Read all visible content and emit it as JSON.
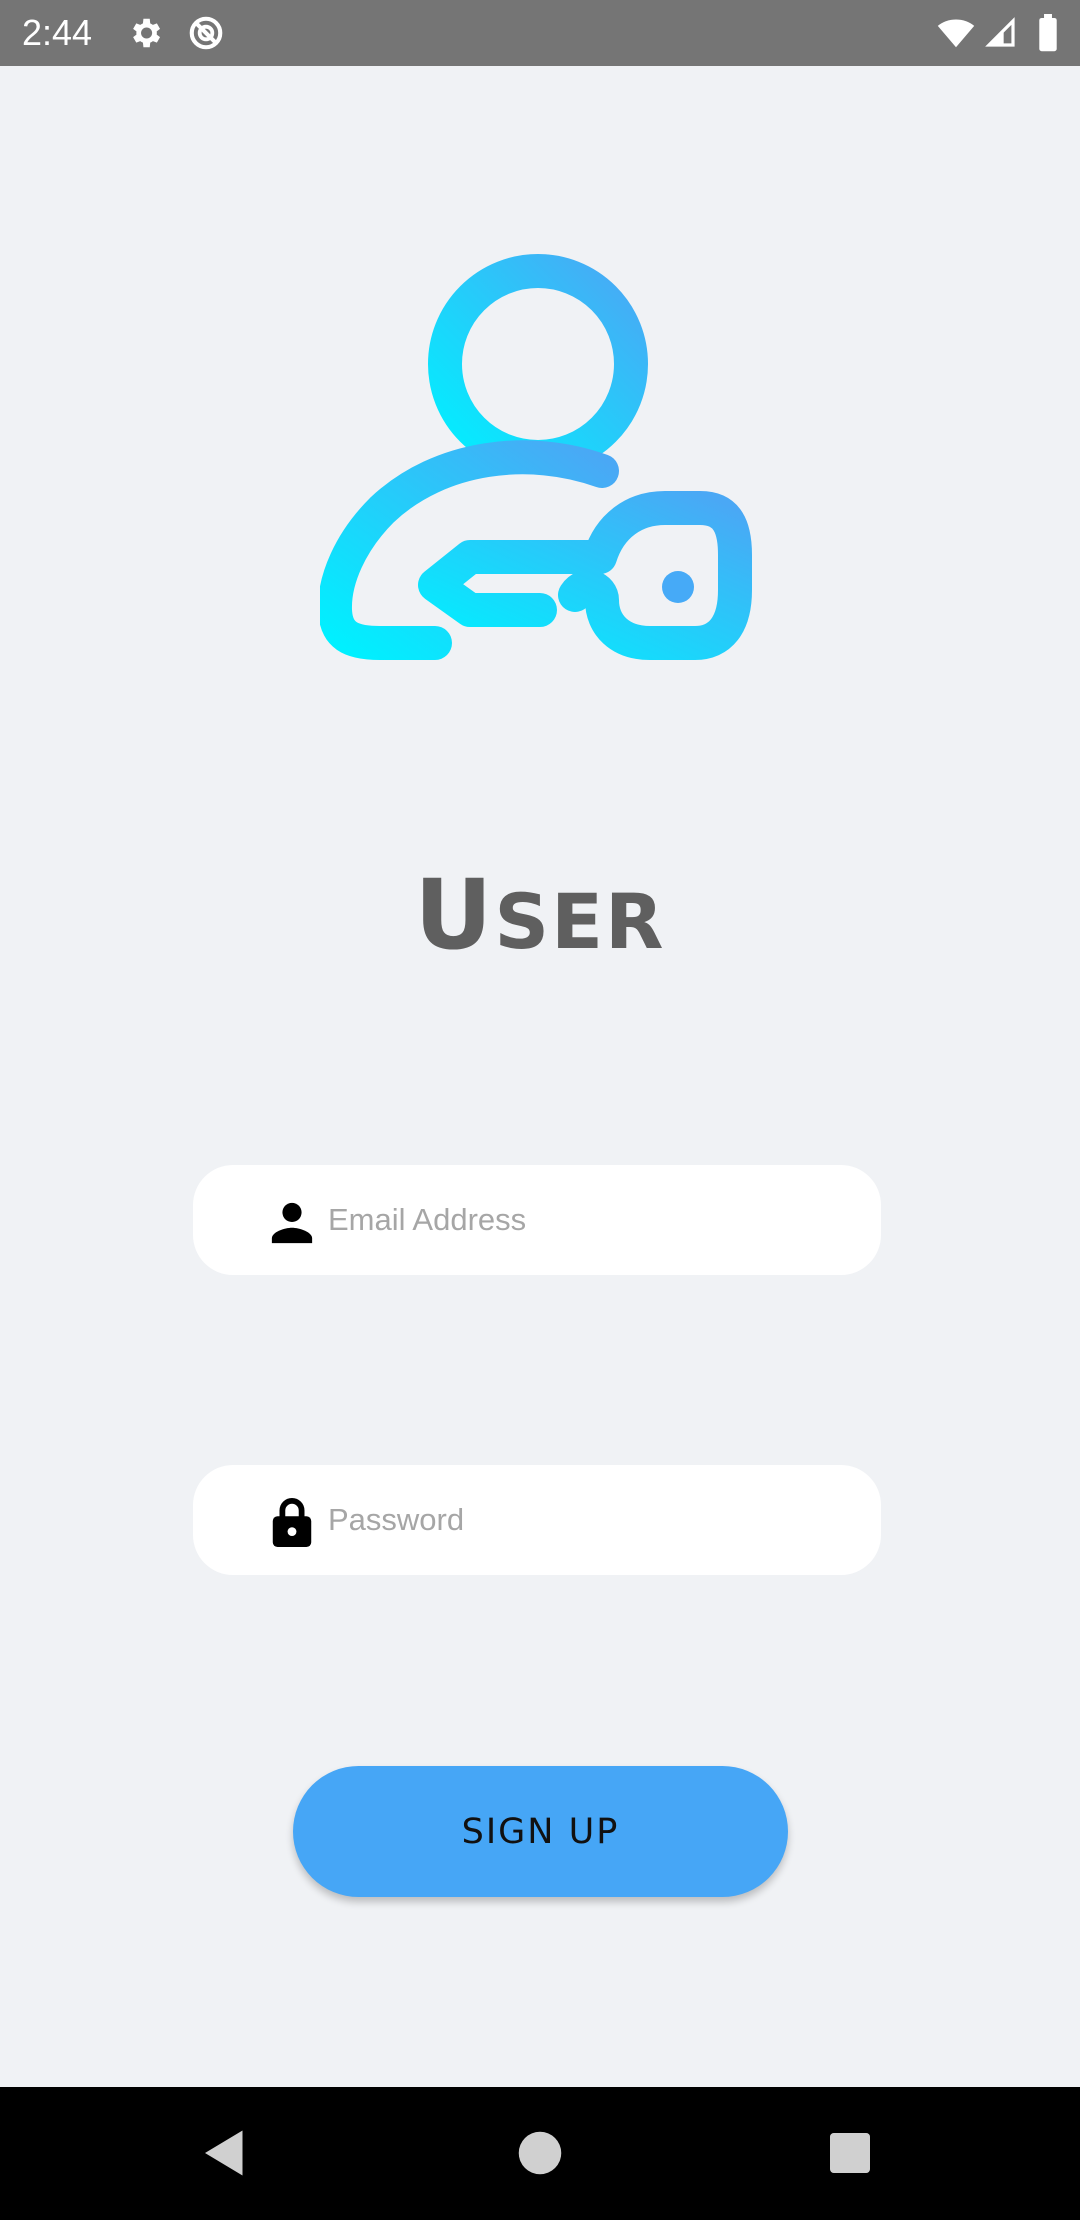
{
  "status_bar": {
    "time": "2:44",
    "icons": [
      "gear-icon",
      "do-not-disturb-icon",
      "wifi-icon",
      "signal-icon",
      "battery-icon"
    ]
  },
  "hero": {
    "icon": "user-key-icon",
    "gradient": [
      "#00f0ff",
      "#4aa8f5"
    ]
  },
  "title": {
    "first": "U",
    "rest": "SER"
  },
  "form": {
    "email": {
      "placeholder": "Email Address",
      "value": "",
      "icon": "person-icon"
    },
    "password": {
      "placeholder": "Password",
      "value": "",
      "icon": "lock-icon"
    },
    "signup_label": "SIGN UP"
  },
  "nav_bar": {
    "icons": [
      "back-icon",
      "home-icon",
      "recents-icon"
    ]
  },
  "colors": {
    "background": "#f0f2f5",
    "accent": "#46a6f6",
    "status_bar": "#757575"
  }
}
